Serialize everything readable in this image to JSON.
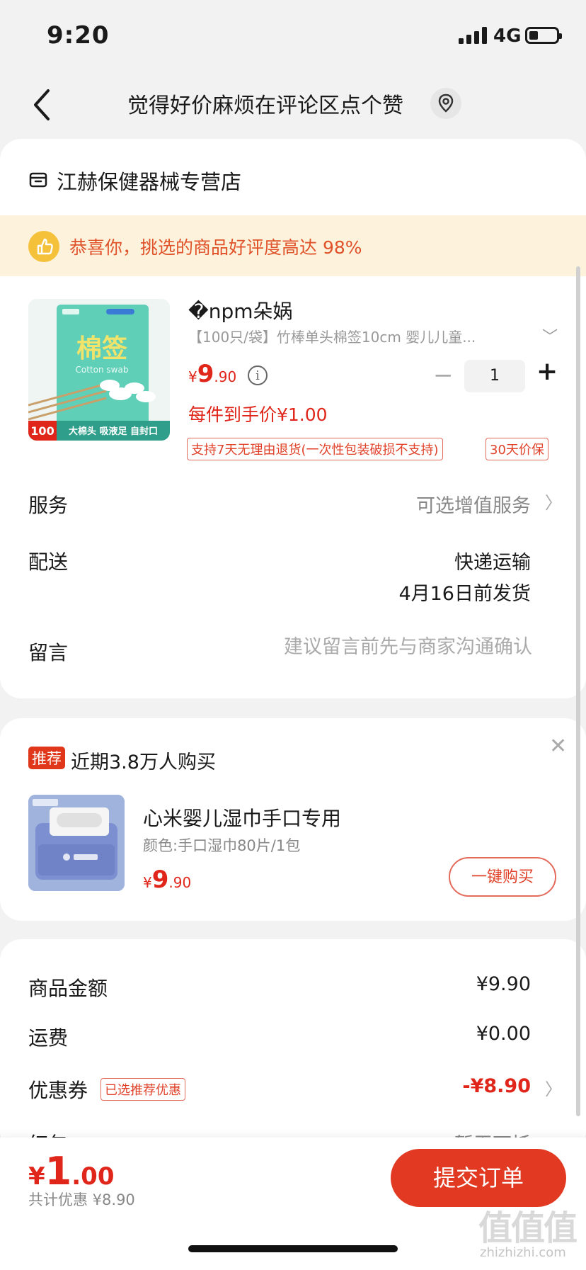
{
  "status_bar": {
    "time": "9:20",
    "network": "4G"
  },
  "nav": {
    "title": "觉得好价麻烦在评论区点个赞"
  },
  "shop": {
    "name": "江赫保健器械专营店"
  },
  "banner": {
    "text": "恭喜你，挑选的商品好评度高达 98%"
  },
  "product": {
    "title": "�npm朵娲",
    "image_text": {
      "brand": "棉签",
      "sub": "Cotton swab",
      "badge": "100",
      "slogan": "大棉头 吸液足 自封口"
    },
    "spec": "【100只/袋】竹棒单头棉签10cm  婴儿儿童...",
    "price": {
      "yen": "¥",
      "int": "9",
      "dec": ".90"
    },
    "quantity": "1",
    "unit_price": "每件到手价¥1.00",
    "tags": [
      "支持7天无理由退货(一次性包装破损不支持)",
      "30天价保"
    ]
  },
  "rows": {
    "service_label": "服务",
    "service_value": "可选增值服务",
    "delivery_label": "配送",
    "delivery_method": "快递运输",
    "delivery_date": "4月16日前发货",
    "message_label": "留言",
    "message_placeholder": "建议留言前先与商家沟通确认"
  },
  "recommend": {
    "badge": "推荐",
    "text": "近期3.8万人购买",
    "title": "心米婴儿湿巾手口专用",
    "spec": "颜色:手口湿巾80片/1包",
    "price": {
      "yen": "¥",
      "int": "9",
      "dec": ".90"
    },
    "button": "一键购买"
  },
  "summary": {
    "goods_amount_label": "商品金额",
    "goods_amount_value": "¥9.90",
    "shipping_label": "运费",
    "shipping_value": "¥0.00",
    "coupon_label": "优惠券",
    "coupon_tag": "已选推荐优惠",
    "coupon_value": "-¥8.90",
    "hidden_label": "红包",
    "hidden_value": "暂无可抵"
  },
  "bottom": {
    "total": {
      "yen": "¥",
      "int": "1",
      "dec": ".00"
    },
    "discount": "共计优惠 ¥8.90",
    "submit": "提交订单"
  },
  "watermark": {
    "logo": "值值值",
    "url": "zhizhizhi.com"
  },
  "colors": {
    "accent": "#e0261a",
    "submit_bg": "#e23a22",
    "banner_bg": "#fdf3dc"
  }
}
